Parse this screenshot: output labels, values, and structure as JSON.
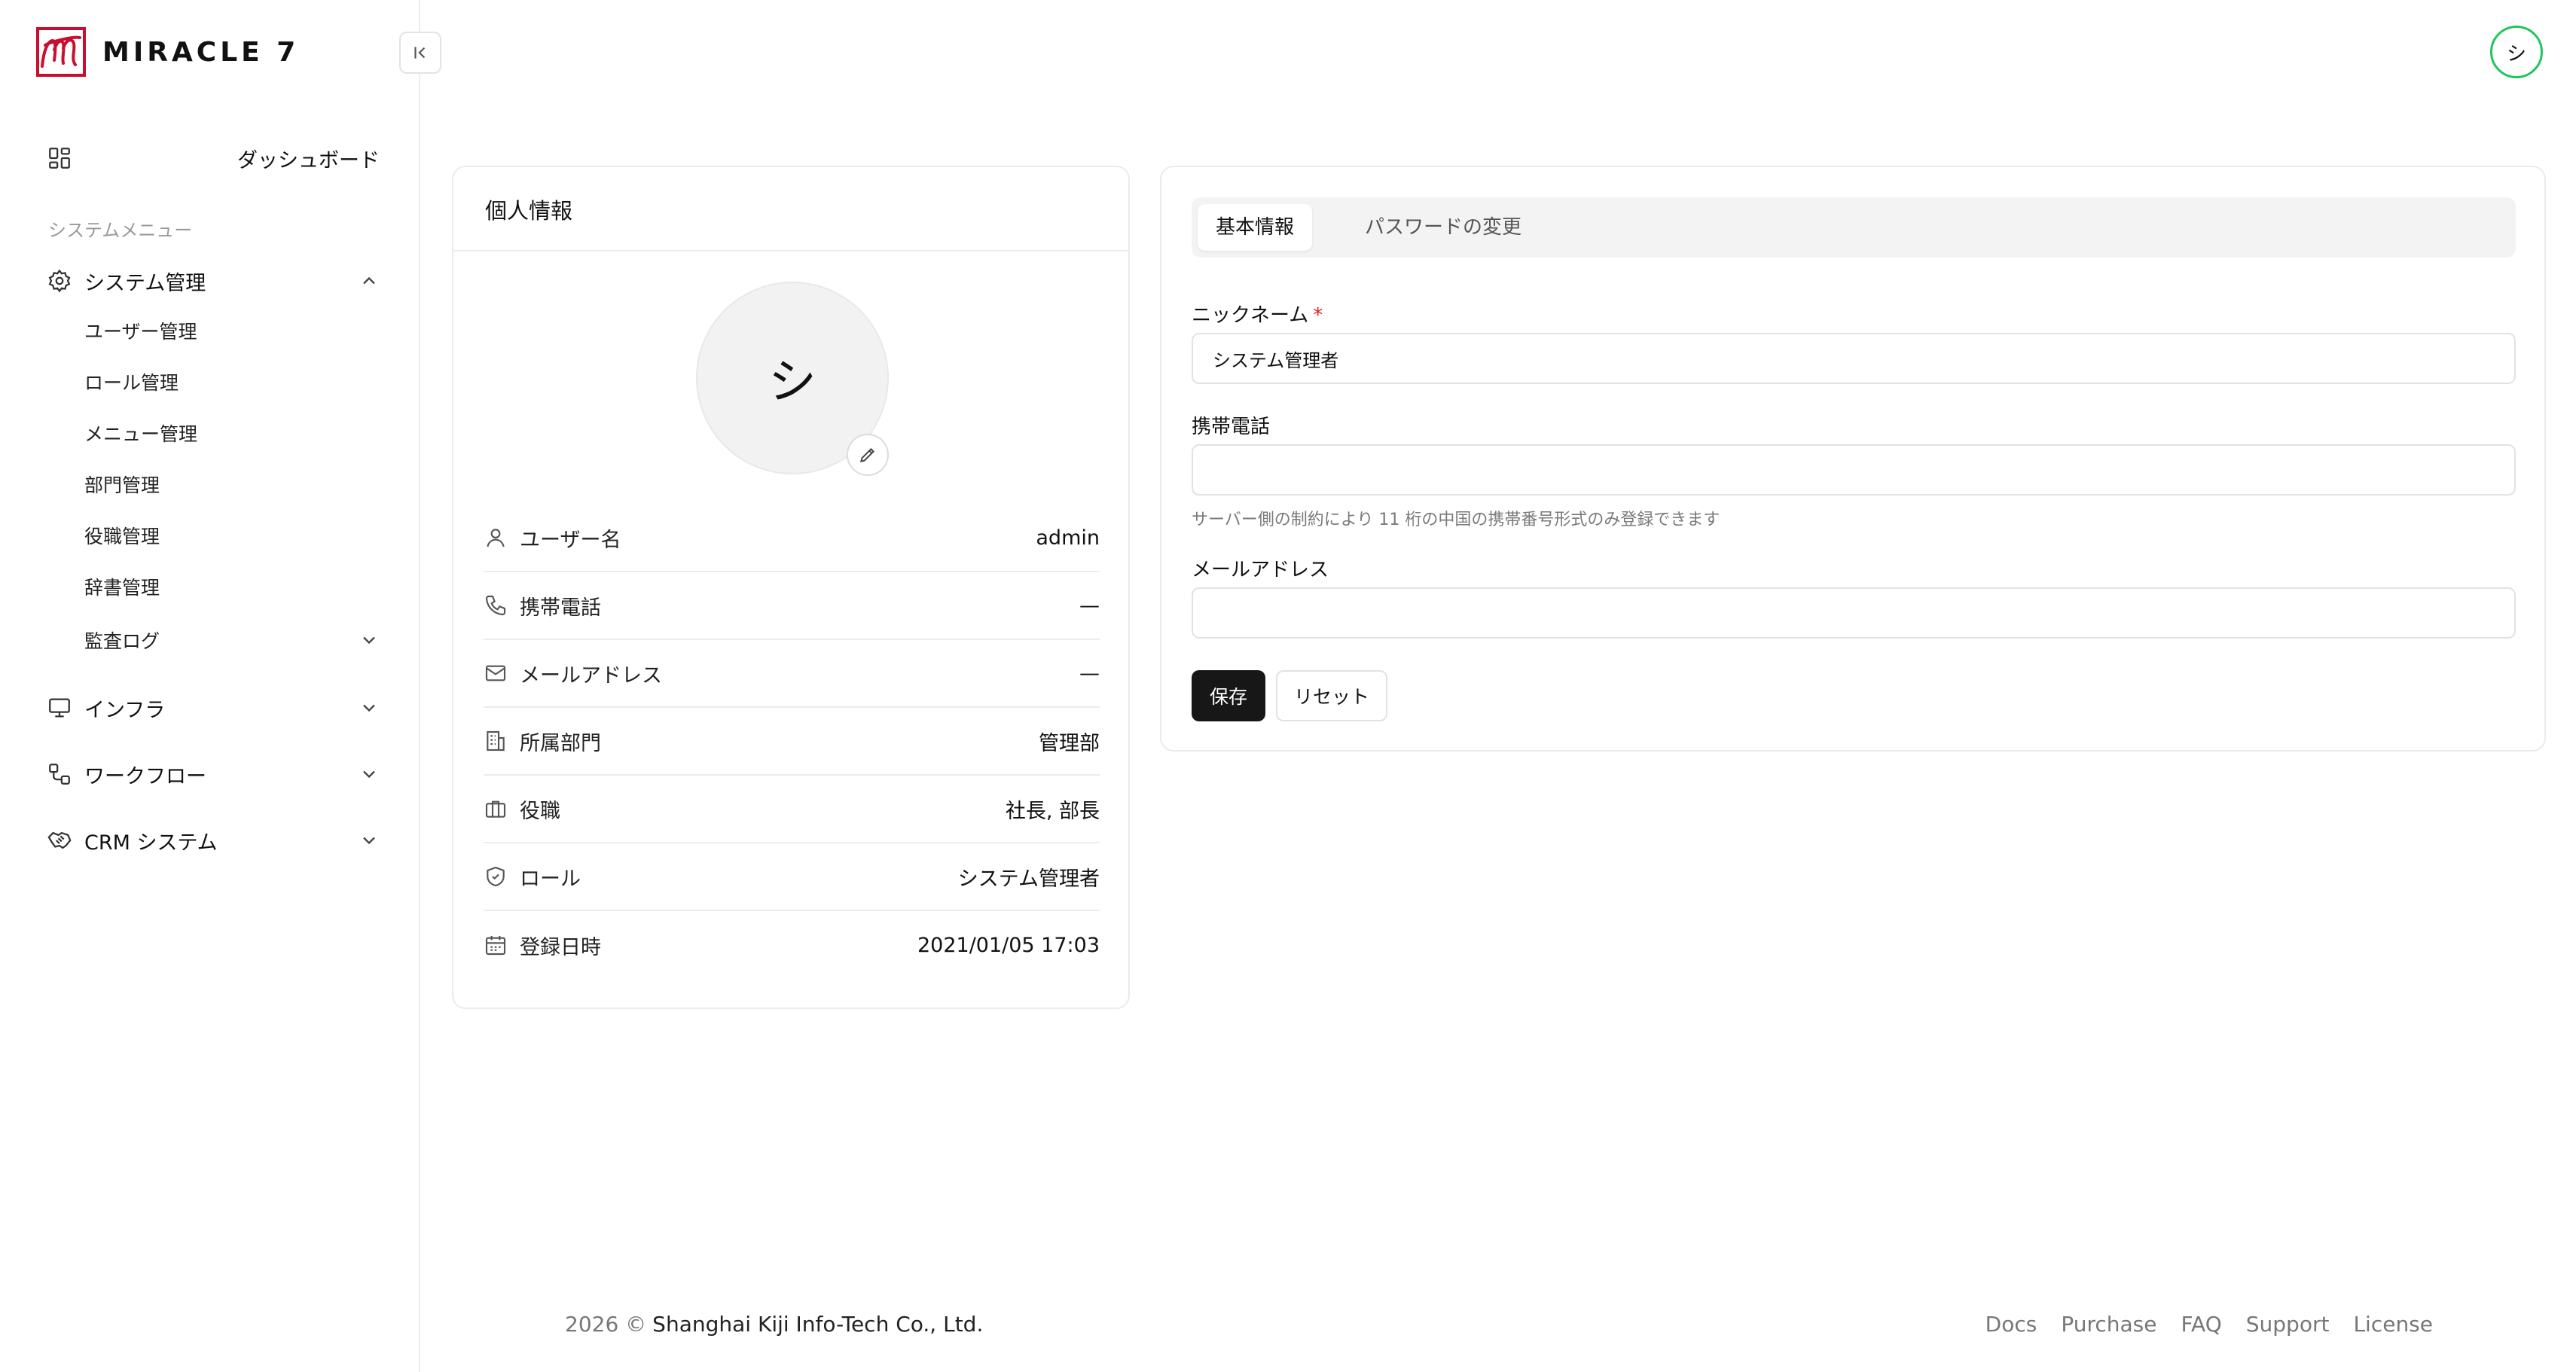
{
  "brand": {
    "name": "MIRACLE 7",
    "logo_color": "#c8102e"
  },
  "sidebar": {
    "dashboard": "ダッシュボード",
    "section_title": "システムメニュー",
    "system": {
      "label": "システム管理",
      "items": [
        "ユーザー管理",
        "ロール管理",
        "メニュー管理",
        "部門管理",
        "役職管理",
        "辞書管理",
        "監査ログ"
      ]
    },
    "infra": "インフラ",
    "workflow": "ワークフロー",
    "crm": "CRM システム"
  },
  "header": {
    "avatar_initial": "シ",
    "avatar_ring_color": "#22c55e"
  },
  "profile_card": {
    "title": "個人情報",
    "avatar_initial": "シ",
    "rows": [
      {
        "icon": "user-icon",
        "label": "ユーザー名",
        "value": "admin"
      },
      {
        "icon": "phone-icon",
        "label": "携帯電話",
        "value": "—"
      },
      {
        "icon": "mail-icon",
        "label": "メールアドレス",
        "value": "—"
      },
      {
        "icon": "building-icon",
        "label": "所属部門",
        "value": "管理部"
      },
      {
        "icon": "briefcase-icon",
        "label": "役職",
        "value": "社長, 部長"
      },
      {
        "icon": "shield-icon",
        "label": "ロール",
        "value": "システム管理者"
      },
      {
        "icon": "calendar-icon",
        "label": "登録日時",
        "value": "2021/01/05 17:03"
      }
    ]
  },
  "form_card": {
    "tabs": [
      "基本情報",
      "パスワードの変更"
    ],
    "nickname": {
      "label": "ニックネーム",
      "required_mark": "*",
      "value": "システム管理者"
    },
    "phone": {
      "label": "携帯電話",
      "value": "",
      "hint": "サーバー側の制約により 11 桁の中国の携帯番号形式のみ登録できます"
    },
    "email": {
      "label": "メールアドレス",
      "value": ""
    },
    "save_label": "保存",
    "reset_label": "リセット"
  },
  "footer": {
    "copyright": "2026 ©",
    "company": "Shanghai Kiji Info-Tech Co., Ltd.",
    "links": [
      "Docs",
      "Purchase",
      "FAQ",
      "Support",
      "License"
    ]
  }
}
